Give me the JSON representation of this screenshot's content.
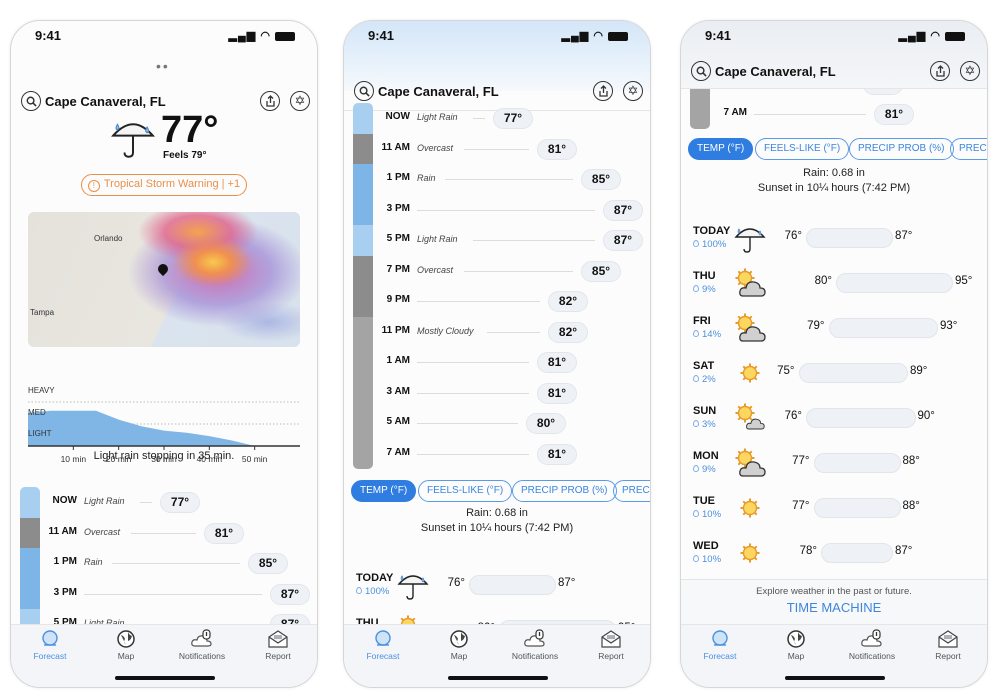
{
  "status": {
    "time": "9:41",
    "icons": "signal wifi battery"
  },
  "header": {
    "location": "Cape Canaveral, FL"
  },
  "current": {
    "temp": "77°",
    "feels": "Feels 79°",
    "icon": "umbrella-rain-icon",
    "warning": "Tropical Storm Warning | +1",
    "warning_color": "#e8904a"
  },
  "map": {
    "labels": [
      "Orlando",
      "Tampa"
    ]
  },
  "precip_chart": {
    "type": "area",
    "levels": [
      "HEAVY",
      "MED",
      "LIGHT"
    ],
    "x_ticks": [
      "10 min",
      "20 min",
      "30 min",
      "40 min",
      "50 min"
    ],
    "x_range_min": [
      0,
      60
    ],
    "intensity_scale": "0 none, 1 light/med boundary, 2 med/heavy boundary",
    "x": [
      0,
      5,
      10,
      15,
      20,
      25,
      30,
      35,
      40,
      45,
      50,
      55,
      60
    ],
    "intensity": [
      1.5,
      1.6,
      1.6,
      1.6,
      1.2,
      0.9,
      0.7,
      0.6,
      0.45,
      0.25,
      0,
      0,
      0
    ],
    "color": "#7fb6e6",
    "summary": "Light rain stopping in 35 min."
  },
  "condition_colors": {
    "Light Rain": "#a9cff0",
    "Overcast": "#8c8c8c",
    "Rain": "#7cb5e6",
    "Mostly Cloudy": "#a4a4a4"
  },
  "hourly": [
    {
      "time": "NOW",
      "cond": "Light Rain",
      "temp": "77°",
      "t": 77,
      "band": "Light Rain"
    },
    {
      "time": "11 AM",
      "cond": "Overcast",
      "temp": "81°",
      "t": 81,
      "band": "Overcast"
    },
    {
      "time": "1 PM",
      "cond": "Rain",
      "temp": "85°",
      "t": 85,
      "band": "Rain"
    },
    {
      "time": "3 PM",
      "cond": "",
      "temp": "87°",
      "t": 87,
      "band": "Rain"
    },
    {
      "time": "5 PM",
      "cond": "Light Rain",
      "temp": "87°",
      "t": 87,
      "band": "Light Rain"
    },
    {
      "time": "7 PM",
      "cond": "Overcast",
      "temp": "85°",
      "t": 85,
      "band": "Overcast"
    },
    {
      "time": "9 PM",
      "cond": "",
      "temp": "82°",
      "t": 82,
      "band": "Overcast"
    },
    {
      "time": "11 PM",
      "cond": "Mostly Cloudy",
      "temp": "82°",
      "t": 82,
      "band": "Mostly Cloudy"
    },
    {
      "time": "1 AM",
      "cond": "",
      "temp": "81°",
      "t": 81,
      "band": "Mostly Cloudy"
    },
    {
      "time": "3 AM",
      "cond": "",
      "temp": "81°",
      "t": 81,
      "band": "Mostly Cloudy"
    },
    {
      "time": "5 AM",
      "cond": "",
      "temp": "80°",
      "t": 80,
      "band": "Mostly Cloudy"
    },
    {
      "time": "7 AM",
      "cond": "",
      "temp": "81°",
      "t": 81,
      "band": "Mostly Cloudy"
    }
  ],
  "chips": [
    {
      "label": "TEMP (°F)",
      "active": true
    },
    {
      "label": "FEELS-LIKE (°F)",
      "active": false
    },
    {
      "label": "PRECIP PROB (%)",
      "active": false
    },
    {
      "label": "PRECIP",
      "active": false
    }
  ],
  "summary": {
    "rain": "Rain: 0.68 in",
    "sunset": "Sunset in 10¼ hours (7:42 PM)"
  },
  "daily": [
    {
      "day": "TODAY",
      "precip": "100%",
      "icon": "umbrella-rain-icon",
      "low": "76°",
      "high": "87°",
      "lo": 76,
      "hi": 87
    },
    {
      "day": "THU",
      "precip": "9%",
      "icon": "partly-cloudy-icon",
      "low": "80°",
      "high": "95°",
      "lo": 80,
      "hi": 95
    },
    {
      "day": "FRI",
      "precip": "14%",
      "icon": "partly-cloudy-icon",
      "low": "79°",
      "high": "93°",
      "lo": 79,
      "hi": 93
    },
    {
      "day": "SAT",
      "precip": "2%",
      "icon": "sun-icon",
      "low": "75°",
      "high": "89°",
      "lo": 75,
      "hi": 89
    },
    {
      "day": "SUN",
      "precip": "3%",
      "icon": "sun-small-cloud-icon",
      "low": "76°",
      "high": "90°",
      "lo": 76,
      "hi": 90
    },
    {
      "day": "MON",
      "precip": "9%",
      "icon": "partly-cloudy-icon",
      "low": "77°",
      "high": "88°",
      "lo": 77,
      "hi": 88
    },
    {
      "day": "TUE",
      "precip": "10%",
      "icon": "sun-icon",
      "low": "77°",
      "high": "88°",
      "lo": 77,
      "hi": 88
    },
    {
      "day": "WED",
      "precip": "10%",
      "icon": "sun-icon",
      "low": "78°",
      "high": "87°",
      "lo": 78,
      "hi": 87
    }
  ],
  "time_machine": {
    "caption": "Explore weather in the past or future.",
    "label": "TIME MACHINE"
  },
  "tabs": [
    {
      "label": "Forecast",
      "icon": "forecast-icon",
      "active": true
    },
    {
      "label": "Map",
      "icon": "globe-icon",
      "active": false
    },
    {
      "label": "Notifications",
      "icon": "notification-cloud-icon",
      "active": false
    },
    {
      "label": "Report",
      "icon": "envelope-icon",
      "active": false
    }
  ],
  "accent": "#2f7de1"
}
